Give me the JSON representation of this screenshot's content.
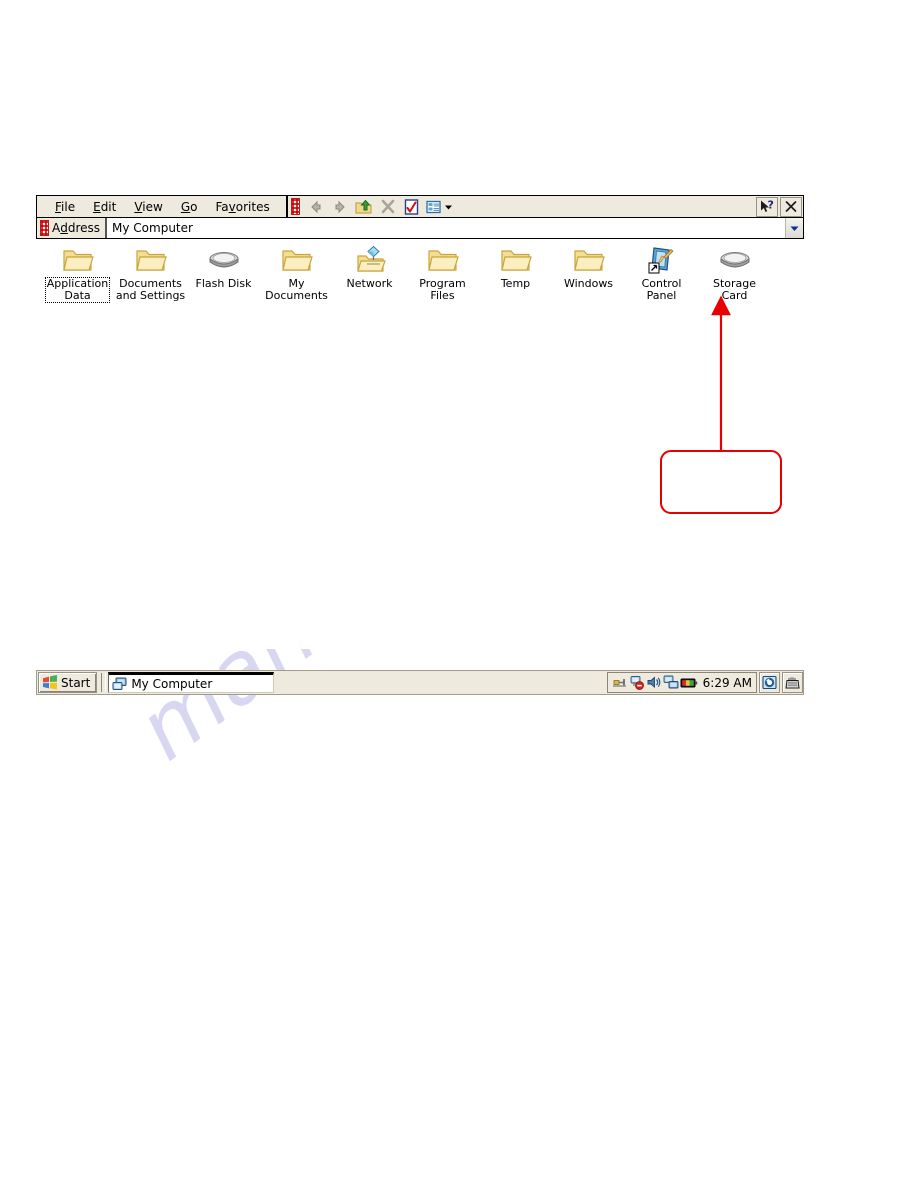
{
  "window": {
    "title": "My Computer",
    "menus": [
      {
        "label": "File",
        "accel": "F"
      },
      {
        "label": "Edit",
        "accel": "E"
      },
      {
        "label": "View",
        "accel": "V"
      },
      {
        "label": "Go",
        "accel": "G"
      },
      {
        "label": "Favorites",
        "accel": "v"
      }
    ],
    "toolbar_buttons": [
      {
        "name": "back-button",
        "icon": "arrow-left-icon",
        "enabled": false
      },
      {
        "name": "forward-button",
        "icon": "arrow-right-icon",
        "enabled": false
      },
      {
        "name": "up-one-level-button",
        "icon": "up-folder-icon",
        "enabled": true
      },
      {
        "name": "delete-button",
        "icon": "close-x-icon",
        "enabled": false
      },
      {
        "name": "properties-button",
        "icon": "properties-page-icon",
        "enabled": true
      },
      {
        "name": "views-button",
        "icon": "views-list-icon",
        "enabled": true
      }
    ],
    "help_button_label": "?",
    "close_button_label": "×"
  },
  "address": {
    "label": "Address",
    "value": "My Computer",
    "placeholder": "My Computer",
    "dropdown_icon": "chevron-down-icon"
  },
  "items": [
    {
      "label": "Application\nData",
      "icon": "folder-icon",
      "selected": true
    },
    {
      "label": "Documents\nand Settings",
      "icon": "folder-icon",
      "selected": false
    },
    {
      "label": "Flash Disk",
      "icon": "drive-icon",
      "selected": false
    },
    {
      "label": "My\nDocuments",
      "icon": "folder-icon",
      "selected": false
    },
    {
      "label": "Network",
      "icon": "network-folder-icon",
      "selected": false
    },
    {
      "label": "Program Files",
      "icon": "folder-icon",
      "selected": false
    },
    {
      "label": "Temp",
      "icon": "folder-icon",
      "selected": false
    },
    {
      "label": "Windows",
      "icon": "folder-icon",
      "selected": false
    },
    {
      "label": "Control\nPanel",
      "icon": "control-panel-icon",
      "selected": false
    },
    {
      "label": "Storage Card",
      "icon": "drive-icon",
      "selected": false
    }
  ],
  "taskbar": {
    "start_label": "Start",
    "task_label": "My Computer",
    "clock": "6:29 AM",
    "tray_icons": [
      "connector-plug-icon",
      "network-error-icon",
      "volume-icon",
      "network-desktop-icon",
      "battery-icon"
    ],
    "tray_buttons": [
      "desktop-toggle-icon",
      "keyboard-sip-icon"
    ]
  },
  "annotation": {
    "callout_text": "",
    "arrow_color": "#e60000",
    "box_color": "#e60000",
    "target": "Storage Card"
  },
  "watermark": {
    "text": "manualshive.com",
    "color": "#c9c9ee"
  }
}
